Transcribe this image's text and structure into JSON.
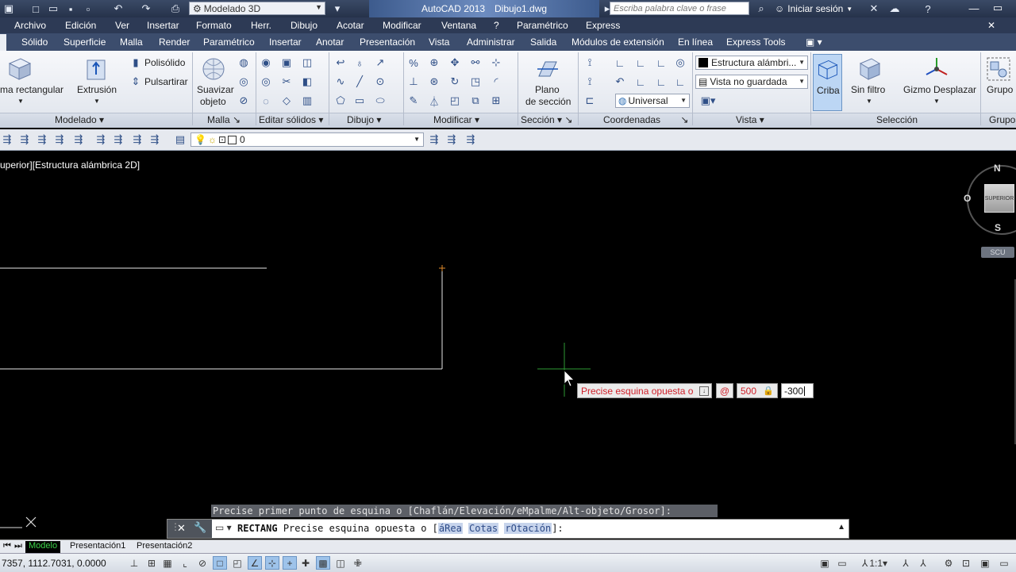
{
  "titlebar": {
    "workspace": "Modelado 3D",
    "app_name": "AutoCAD 2013",
    "file_name": "Dibujo1.dwg",
    "search_placeholder": "Escriba palabra clave o frase",
    "login_label": "Iniciar sesión"
  },
  "menubar": {
    "items": [
      "Archivo",
      "Edición",
      "Ver",
      "Insertar",
      "Formato",
      "Herr.",
      "Dibujo",
      "Acotar",
      "Modificar",
      "Ventana",
      "?",
      "Paramétrico",
      "Express"
    ]
  },
  "ribbon_tabs": {
    "items": [
      "Sólido",
      "Superficie",
      "Malla",
      "Render",
      "Paramétrico",
      "Insertar",
      "Anotar",
      "Presentación",
      "Vista",
      "Administrar",
      "Salida",
      "Módulos de extensión",
      "En línea",
      "Express Tools"
    ]
  },
  "ribbon": {
    "modelado": {
      "box_label": "ma rectangular",
      "extrude_label": "Extrusión",
      "polysolid_label": "Polisólido",
      "presspull_label": "Pulsartirar",
      "panel_label": "Modelado"
    },
    "malla": {
      "smooth_label_1": "Suavizar",
      "smooth_label_2": "objeto",
      "panel_label": "Malla"
    },
    "editar_solidos": {
      "panel_label": "Editar sólidos"
    },
    "dibujo": {
      "panel_label": "Dibujo"
    },
    "modificar": {
      "panel_label": "Modificar"
    },
    "seccion": {
      "plane_label_1": "Plano",
      "plane_label_2": "de sección",
      "panel_label": "Sección"
    },
    "coordenadas": {
      "ucs_value": "Universal",
      "panel_label": "Coordenadas"
    },
    "vista": {
      "visual_style": "Estructura alámbri...",
      "named_view": "Vista no guardada",
      "panel_label": "Vista"
    },
    "seleccion": {
      "culling_label": "Criba",
      "filter_label": "Sin filtro",
      "gizmo_label": "Gizmo Desplazar",
      "panel_label": "Selección"
    },
    "grupos": {
      "group_label": "Grupo",
      "panel_label": "Grupos"
    }
  },
  "layer_toolbar": {
    "current_layer": "0"
  },
  "viewport": {
    "label": "uperior][Estructura alámbrica 2D]",
    "compass_n": "N",
    "compass_s": "S",
    "compass_o": "O",
    "cube_face": "SUPERIOR",
    "ucs_label": "SCU"
  },
  "dynamic_input": {
    "prompt": "Precise esquina opuesta o",
    "relative_symbol": "@",
    "x_value": "500",
    "y_value": "-300"
  },
  "command_line": {
    "history": "Precise primer punto de esquina o [Chaflán/Elevación/eMpalme/Alt-objeto/Grosor]:",
    "command": "RECTANG",
    "prompt_text": "Precise esquina opuesta o [",
    "option_1": "áRea",
    "option_2": "Cotas",
    "option_3": "rOtación",
    "prompt_end": "]:"
  },
  "layout_tabs": {
    "items": [
      "Modelo",
      "Presentación1",
      "Presentación2"
    ]
  },
  "statusbar": {
    "coordinates": "7357, 1112.7031, 0.0000",
    "annotation_scale": "1:1"
  },
  "colors": {
    "titlebar": "#2d3a55",
    "ribbon_bg": "#eceff4",
    "prompt_red": "#d0202a",
    "model_tab_green": "#3cd34a"
  }
}
